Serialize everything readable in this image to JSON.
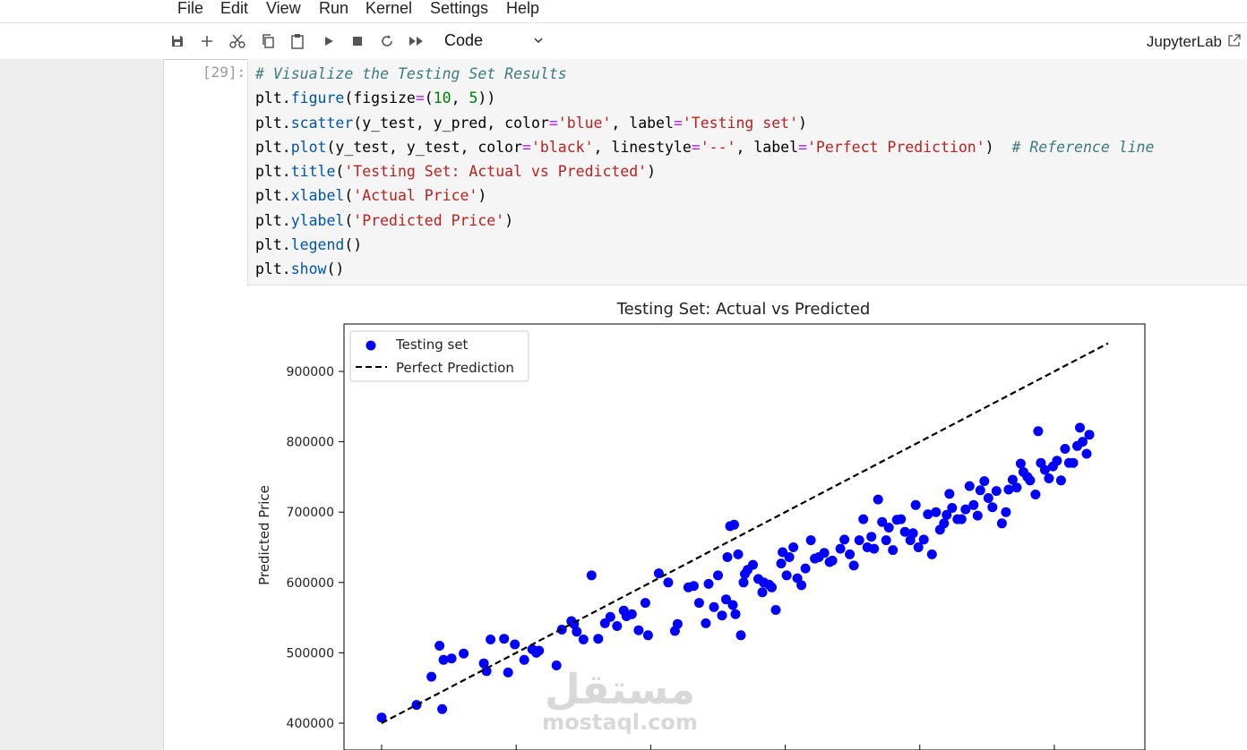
{
  "menu": [
    "File",
    "Edit",
    "View",
    "Run",
    "Kernel",
    "Settings",
    "Help"
  ],
  "toolbar": {
    "icons": [
      "save-icon",
      "add-cell-icon",
      "cut-icon",
      "copy-icon",
      "paste-icon",
      "run-icon",
      "stop-icon",
      "restart-icon",
      "run-all-icon"
    ],
    "cell_type": "Code",
    "brand": "JupyterLab"
  },
  "cell": {
    "prompt": "[29]:",
    "code_lines": [
      "# Visualize the Testing Set Results",
      "plt.figure(figsize=(10, 5))",
      "plt.scatter(y_test, y_pred, color='blue', label='Testing set')",
      "plt.plot(y_test, y_test, color='black', linestyle='--', label='Perfect Prediction')  # Reference line",
      "plt.title('Testing Set: Actual vs Predicted')",
      "plt.xlabel('Actual Price')",
      "plt.ylabel('Predicted Price')",
      "plt.legend()",
      "plt.show()"
    ]
  },
  "chart_data": {
    "type": "scatter",
    "title": "Testing Set: Actual vs Predicted",
    "ylabel": "Predicted Price",
    "xlabel": "",
    "yticks": [
      "400000",
      "500000",
      "600000",
      "700000",
      "800000",
      "900000"
    ],
    "ylim": [
      380000,
      950000
    ],
    "xlim": [
      380000,
      950000
    ],
    "legend_position": "top-left",
    "colors": {
      "points": "#0000ff",
      "line": "#000000"
    },
    "series": [
      {
        "name": "Testing set",
        "kind": "scatter",
        "points": [
          [
            400000,
            408000
          ],
          [
            426000,
            426000
          ],
          [
            445000,
            420000
          ],
          [
            437000,
            466000
          ],
          [
            443000,
            510000
          ],
          [
            446000,
            490000
          ],
          [
            452000,
            492000
          ],
          [
            461000,
            499000
          ],
          [
            476000,
            485000
          ],
          [
            481000,
            519000
          ],
          [
            478000,
            474000
          ],
          [
            491000,
            520000
          ],
          [
            494000,
            472000
          ],
          [
            499000,
            512000
          ],
          [
            506000,
            490000
          ],
          [
            512000,
            505000
          ],
          [
            515000,
            500000
          ],
          [
            517000,
            503000
          ],
          [
            530000,
            482000
          ],
          [
            534000,
            533000
          ],
          [
            541000,
            545000
          ],
          [
            543000,
            541000
          ],
          [
            545000,
            530000
          ],
          [
            550000,
            519000
          ],
          [
            556000,
            610000
          ],
          [
            561000,
            520000
          ],
          [
            566000,
            542000
          ],
          [
            570000,
            551000
          ],
          [
            575000,
            538000
          ],
          [
            580000,
            560000
          ],
          [
            582000,
            552000
          ],
          [
            586000,
            555000
          ],
          [
            591000,
            532000
          ],
          [
            596000,
            571000
          ],
          [
            598000,
            525000
          ],
          [
            606000,
            613000
          ],
          [
            613000,
            600000
          ],
          [
            618000,
            531000
          ],
          [
            620000,
            541000
          ],
          [
            628000,
            593000
          ],
          [
            632000,
            595000
          ],
          [
            636000,
            571000
          ],
          [
            641000,
            542000
          ],
          [
            643000,
            598000
          ],
          [
            647000,
            565000
          ],
          [
            650000,
            610000
          ],
          [
            653000,
            553000
          ],
          [
            656000,
            576000
          ],
          [
            657000,
            636000
          ],
          [
            659000,
            680000
          ],
          [
            661000,
            568000
          ],
          [
            662000,
            682000
          ],
          [
            663000,
            555000
          ],
          [
            665000,
            640000
          ],
          [
            667000,
            525000
          ],
          [
            669000,
            600000
          ],
          [
            670000,
            612000
          ],
          [
            672000,
            618000
          ],
          [
            676000,
            625000
          ],
          [
            680000,
            605000
          ],
          [
            683000,
            586000
          ],
          [
            684000,
            600000
          ],
          [
            688000,
            597000
          ],
          [
            690000,
            593000
          ],
          [
            693000,
            561000
          ],
          [
            697000,
            627000
          ],
          [
            698000,
            643000
          ],
          [
            701000,
            610000
          ],
          [
            703000,
            636000
          ],
          [
            706000,
            650000
          ],
          [
            709000,
            606000
          ],
          [
            712000,
            596000
          ],
          [
            715000,
            620000
          ],
          [
            719000,
            660000
          ],
          [
            722000,
            634000
          ],
          [
            725000,
            636000
          ],
          [
            729000,
            642000
          ],
          [
            733000,
            629000
          ],
          [
            735000,
            631000
          ],
          [
            741000,
            648000
          ],
          [
            744000,
            661000
          ],
          [
            748000,
            640000
          ],
          [
            751000,
            624000
          ],
          [
            755000,
            660000
          ],
          [
            758000,
            690000
          ],
          [
            761000,
            650000
          ],
          [
            764000,
            665000
          ],
          [
            766000,
            648000
          ],
          [
            769000,
            718000
          ],
          [
            772000,
            686000
          ],
          [
            775000,
            660000
          ],
          [
            777000,
            678000
          ],
          [
            780000,
            646000
          ],
          [
            783000,
            689000
          ],
          [
            786000,
            690000
          ],
          [
            789000,
            672000
          ],
          [
            793000,
            660000
          ],
          [
            795000,
            670000
          ],
          [
            797000,
            710000
          ],
          [
            799000,
            650000
          ],
          [
            803000,
            661000
          ],
          [
            806000,
            697000
          ],
          [
            809000,
            640000
          ],
          [
            812000,
            700000
          ],
          [
            815000,
            675000
          ],
          [
            818000,
            684000
          ],
          [
            820000,
            696000
          ],
          [
            822000,
            726000
          ],
          [
            824000,
            706000
          ],
          [
            828000,
            690000
          ],
          [
            831000,
            690000
          ],
          [
            834000,
            704000
          ],
          [
            837000,
            737000
          ],
          [
            840000,
            710000
          ],
          [
            843000,
            695000
          ],
          [
            845000,
            731000
          ],
          [
            848000,
            744000
          ],
          [
            851000,
            720000
          ],
          [
            854000,
            707000
          ],
          [
            857000,
            730000
          ],
          [
            861000,
            684000
          ],
          [
            864000,
            700000
          ],
          [
            866000,
            732000
          ],
          [
            869000,
            746000
          ],
          [
            872000,
            735000
          ],
          [
            875000,
            769000
          ],
          [
            877000,
            757000
          ],
          [
            880000,
            750000
          ],
          [
            882000,
            745000
          ],
          [
            886000,
            725000
          ],
          [
            888000,
            815000
          ],
          [
            890000,
            770000
          ],
          [
            893000,
            760000
          ],
          [
            896000,
            748000
          ],
          [
            899000,
            765000
          ],
          [
            902000,
            773000
          ],
          [
            905000,
            745000
          ],
          [
            908000,
            790000
          ],
          [
            911000,
            770000
          ],
          [
            914000,
            770000
          ],
          [
            917000,
            794000
          ],
          [
            919000,
            820000
          ],
          [
            921000,
            800000
          ],
          [
            924000,
            783000
          ],
          [
            926000,
            810000
          ]
        ]
      },
      {
        "name": "Perfect Prediction",
        "kind": "line",
        "style": "dashed",
        "points": [
          [
            400000,
            400000
          ],
          [
            940000,
            940000
          ]
        ]
      }
    ]
  },
  "watermark": {
    "arabic": "مستقل",
    "url": "mostaql.com"
  }
}
